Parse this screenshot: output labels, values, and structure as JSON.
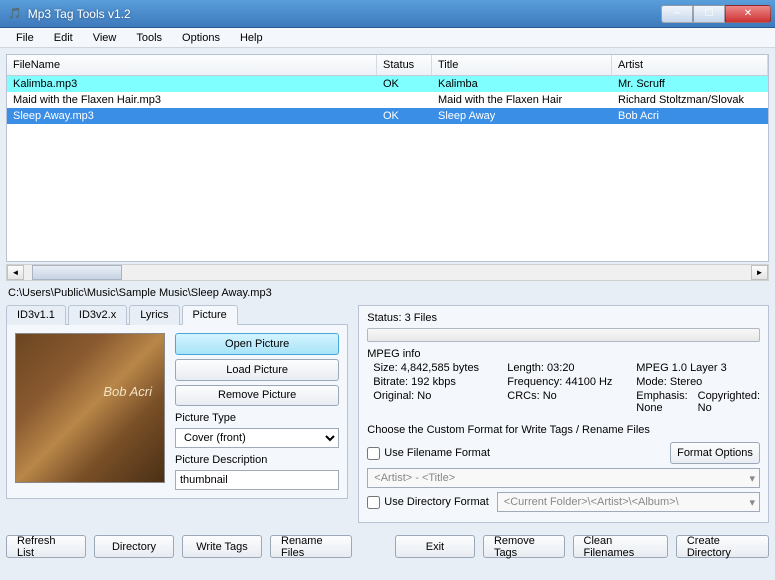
{
  "window": {
    "title": "Mp3 Tag Tools v1.2"
  },
  "menu": [
    "File",
    "Edit",
    "View",
    "Tools",
    "Options",
    "Help"
  ],
  "columns": {
    "filename": "FileName",
    "status": "Status",
    "title": "Title",
    "artist": "Artist"
  },
  "rows": [
    {
      "filename": "Kalimba.mp3",
      "status": "OK",
      "title": "Kalimba",
      "artist": "Mr. Scruff"
    },
    {
      "filename": "Maid with the Flaxen Hair.mp3",
      "status": "",
      "title": "Maid with the Flaxen Hair",
      "artist": "Richard Stoltzman/Slovak"
    },
    {
      "filename": "Sleep Away.mp3",
      "status": "OK",
      "title": "Sleep Away",
      "artist": "Bob Acri"
    }
  ],
  "path": "C:\\Users\\Public\\Music\\Sample Music\\Sleep Away.mp3",
  "tabs": [
    "ID3v1.1",
    "ID3v2.x",
    "Lyrics",
    "Picture"
  ],
  "pic": {
    "open": "Open Picture",
    "load": "Load Picture",
    "remove": "Remove Picture",
    "typelabel": "Picture Type",
    "typevalue": "Cover (front)",
    "desclabel": "Picture Description",
    "descvalue": "thumbnail"
  },
  "right": {
    "status": "Status: 3 Files",
    "mpeg": "MPEG info",
    "size": "Size: 4,842,585 bytes",
    "length": "Length:  03:20",
    "layer": "MPEG 1.0 Layer 3",
    "bitrate": "Bitrate: 192 kbps",
    "freq": "Frequency: 44100 Hz",
    "mode": "Mode: Stereo",
    "orig": "Original: No",
    "crc": "CRCs: No",
    "emph": "Emphasis: None",
    "copy": "Copyrighted: No",
    "custom": "Choose the Custom Format for Write Tags / Rename Files",
    "useff": "Use Filename Format",
    "formatopts": "Format Options",
    "ffval": "<Artist> - <Title>",
    "usedf": "Use Directory Format",
    "dfval": "<Current Folder>\\<Artist>\\<Album>\\"
  },
  "bottom": {
    "refresh": "Refresh List",
    "directory": "Directory",
    "write": "Write Tags",
    "rename": "Rename Files",
    "exit": "Exit",
    "removetags": "Remove Tags",
    "clean": "Clean Filenames",
    "createdir": "Create Directory"
  }
}
